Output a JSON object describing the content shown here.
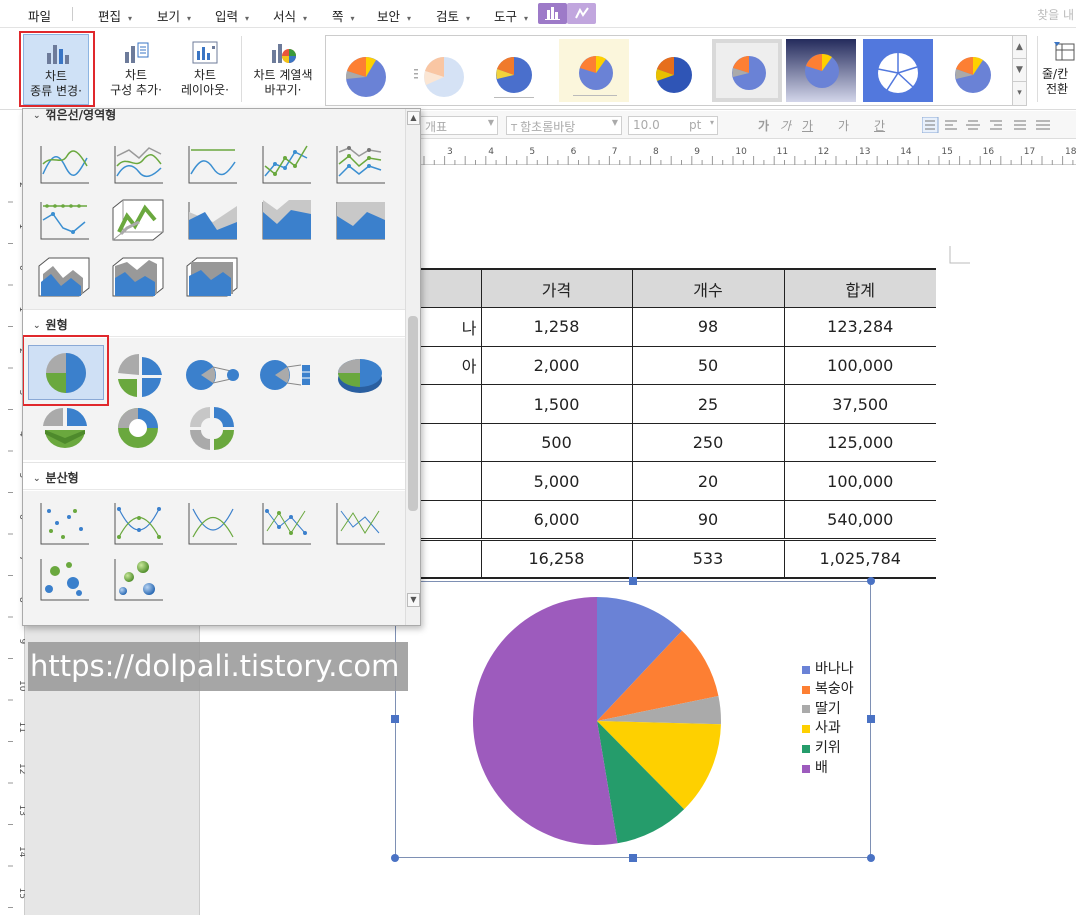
{
  "menubar": {
    "items": [
      {
        "label": "파일",
        "arrow": ""
      },
      {
        "label": "편집",
        "arrow": "▾"
      },
      {
        "label": "보기",
        "arrow": "▾"
      },
      {
        "label": "입력",
        "arrow": "▾"
      },
      {
        "label": "서식",
        "arrow": "▾"
      },
      {
        "label": "쪽",
        "arrow": "▾"
      },
      {
        "label": "보안",
        "arrow": "▾"
      },
      {
        "label": "검토",
        "arrow": "▾"
      },
      {
        "label": "도구",
        "arrow": "▾"
      }
    ],
    "search_hint": "찾을 내"
  },
  "ribbon": {
    "chart_type": {
      "line1": "차트",
      "line2": "종류 변경·"
    },
    "chart_compose": {
      "line1": "차트",
      "line2": "구성 추가·"
    },
    "chart_layout": {
      "line1": "차트",
      "line2": "레이아웃·"
    },
    "chart_color": {
      "line1": "차트 계열색",
      "line2": "바꾸기·"
    },
    "row_col_switch": {
      "line1": "줄/칸",
      "line2": "전환"
    }
  },
  "format_bar": {
    "style": "개표",
    "font": "함초롬바탕",
    "size": "10.0",
    "unit": "pt",
    "bold": "가",
    "italic": "가",
    "underline": "가",
    "strike": "가",
    "color": "간"
  },
  "ruler": {
    "h_ticks": [
      "3",
      "4",
      "5",
      "6",
      "7",
      "8",
      "9",
      "10",
      "11",
      "12",
      "13",
      "14",
      "15",
      "16",
      "17",
      "18"
    ],
    "v_ticks": [
      "2",
      "1",
      "0",
      "1",
      "2",
      "3",
      "4",
      "5",
      "6",
      "7",
      "8",
      "9",
      "10",
      "11",
      "12",
      "13",
      "14",
      "15"
    ]
  },
  "panel": {
    "sections": {
      "line": "꺾은선/영역형",
      "pie": "원형",
      "scatter": "분산형"
    }
  },
  "table": {
    "headers": [
      "",
      "가격",
      "개수",
      "합계"
    ],
    "rows": [
      [
        "나",
        "1,258",
        "98",
        "123,284"
      ],
      [
        "아",
        "2,000",
        "50",
        "100,000"
      ],
      [
        "",
        "1,500",
        "25",
        "37,500"
      ],
      [
        "",
        "500",
        "250",
        "125,000"
      ],
      [
        "",
        "5,000",
        "20",
        "100,000"
      ],
      [
        "",
        "6,000",
        "90",
        "540,000"
      ]
    ],
    "total": [
      "",
      "16,258",
      "533",
      "1,025,784"
    ]
  },
  "chart_data": {
    "type": "pie",
    "categories": [
      "바나나",
      "복숭아",
      "딸기",
      "사과",
      "키위",
      "배"
    ],
    "values": [
      123284,
      100000,
      37500,
      125000,
      100000,
      540000
    ],
    "colors": [
      "#6a82d6",
      "#fd7f33",
      "#aaaaaa",
      "#fed000",
      "#259c6b",
      "#9d5bbd"
    ],
    "legend_position": "right"
  },
  "watermark": "https://dolpali.tistory.com",
  "colors": {
    "accent_purple": "#9d7ac8",
    "selection_red": "#e0282c",
    "selected_blue": "#cfe0f5"
  }
}
